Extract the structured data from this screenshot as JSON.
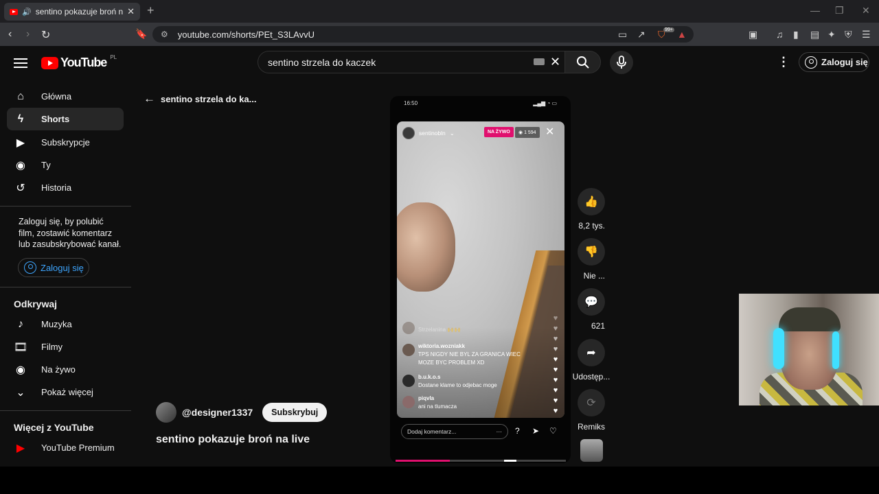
{
  "browser": {
    "tab_title": "sentino pokazuje broń na live",
    "url": "youtube.com/shorts/PEt_S3LAvvU",
    "extension_badge": "99+"
  },
  "header": {
    "logo_text": "YouTube",
    "country_code": "PL",
    "search_value": "sentino strzela do kaczek",
    "sign_in_label": "Zaloguj się"
  },
  "sidebar": {
    "items": [
      {
        "label": "Główna",
        "icon": "home-icon"
      },
      {
        "label": "Shorts",
        "icon": "shorts-icon"
      },
      {
        "label": "Subskrypcje",
        "icon": "subscriptions-icon"
      },
      {
        "label": "Ty",
        "icon": "you-icon"
      },
      {
        "label": "Historia",
        "icon": "history-icon"
      }
    ],
    "note": "Zaloguj się, by polubić film, zostawić komentarz lub zasubskrybować kanał.",
    "sign_in_label": "Zaloguj się",
    "explore_heading": "Odkrywaj",
    "explore": [
      {
        "label": "Muzyka",
        "icon": "music-icon"
      },
      {
        "label": "Filmy",
        "icon": "movies-icon"
      },
      {
        "label": "Na żywo",
        "icon": "live-icon"
      },
      {
        "label": "Pokaż więcej",
        "icon": "chevron-down-icon"
      }
    ],
    "more_heading": "Więcej z YouTube",
    "more": [
      {
        "label": "YouTube Premium",
        "icon": "youtube-premium-icon"
      }
    ]
  },
  "short": {
    "back_title": "sentino strzela do ka...",
    "channel": "@designer1337",
    "subscribe_label": "Subskrybuj",
    "title": "sentino pokazuje broń na live"
  },
  "video": {
    "phone_time": "16:50",
    "ig_username": "sentinobln",
    "live_label": "NA ŻYWO",
    "viewers": "1 594",
    "faded_comment": "Strzelanina",
    "comments": [
      {
        "user": "wiktoria.wozniakk",
        "text": "TPS NIGDY NIE BYL ZA GRANICA WIEC MOZE BYC PROBLEM XD"
      },
      {
        "user": "b.u.k.o.s",
        "text": "Dostane klame to odjebac moge"
      },
      {
        "user": "piqvla",
        "text": "ani na tlumacza"
      }
    ],
    "comment_placeholder": "Dodaj komentarz...",
    "progress_fraction": 0.32
  },
  "actions": {
    "likes": "8,2 tys.",
    "dislike": "Nie ...",
    "comments": "621",
    "share": "Udostęp...",
    "remix": "Remiks"
  }
}
